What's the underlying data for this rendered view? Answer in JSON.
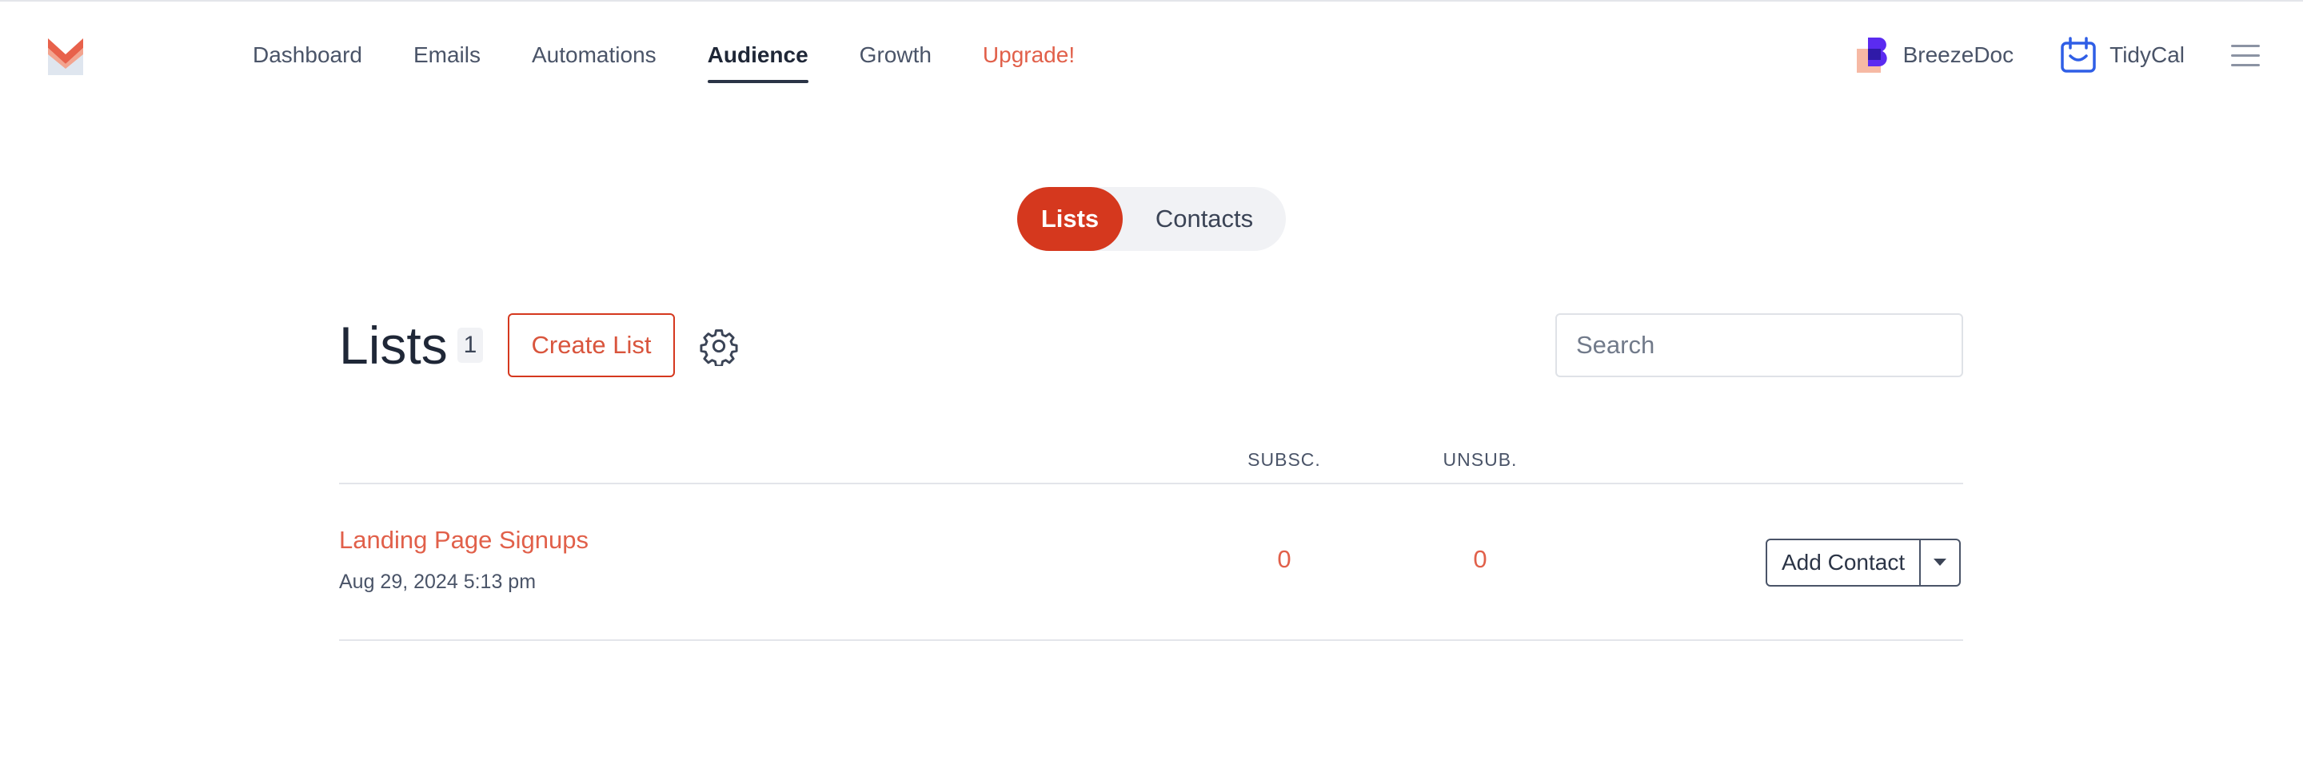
{
  "nav": {
    "items": [
      {
        "label": "Dashboard",
        "active": false
      },
      {
        "label": "Emails",
        "active": false
      },
      {
        "label": "Automations",
        "active": false
      },
      {
        "label": "Audience",
        "active": true
      },
      {
        "label": "Growth",
        "active": false
      },
      {
        "label": "Upgrade!",
        "active": false,
        "highlight": true
      }
    ],
    "apps": [
      {
        "label": "BreezeDoc",
        "icon": "breezedoc-logo-icon"
      },
      {
        "label": "TidyCal",
        "icon": "tidycal-calendar-icon"
      }
    ]
  },
  "toggle": {
    "active_label": "Lists",
    "inactive_label": "Contacts"
  },
  "lists_header": {
    "title": "Lists",
    "count": "1",
    "create_label": "Create List",
    "search_placeholder": "Search"
  },
  "table": {
    "columns": {
      "subscribed": "SUBSC.",
      "unsubscribed": "UNSUB."
    },
    "rows": [
      {
        "name": "Landing Page Signups",
        "created": "Aug 29, 2024 5:13 pm",
        "subscribed": "0",
        "unsubscribed": "0",
        "action_label": "Add Contact"
      }
    ]
  },
  "colors": {
    "brand": "#d5381e",
    "accent_text": "#e1604a",
    "text": "#2b3446"
  }
}
